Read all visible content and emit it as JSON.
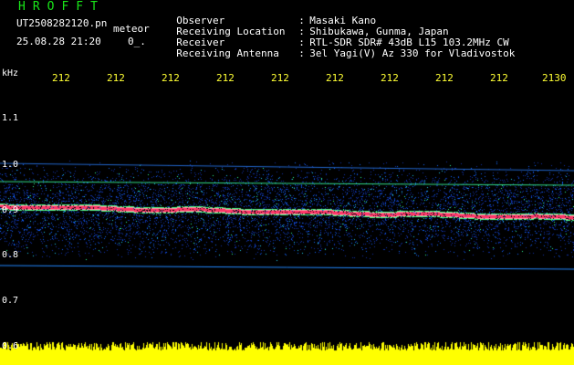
{
  "header": {
    "app_title": "HROFFT",
    "file_name": "UT2508282120.pn",
    "mode": "meteor",
    "timestamp": "25.08.28 21:20",
    "scale": "0_.",
    "info": [
      {
        "key": "Observer",
        "sep": ":",
        "value": "Masaki Kano"
      },
      {
        "key": "Receiving Location",
        "sep": ":",
        "value": "Shibukawa, Gunma, Japan"
      },
      {
        "key": "Receiver",
        "sep": ":",
        "value": "RTL-SDR SDR# 43dB L15 103.2MHz CW"
      },
      {
        "key": "Receiving Antenna",
        "sep": ":",
        "value": "3el Yagi(V) Az 330 for Vladivostok"
      }
    ]
  },
  "axes": {
    "y_unit": "kHz",
    "x_ticks": [
      "212",
      "212",
      "212",
      "212",
      "212",
      "212",
      "212",
      "212",
      "212",
      "2130"
    ],
    "y_ticks": [
      "1.1",
      "1.0",
      "0.9",
      "0.8",
      "0.7",
      "0.6"
    ]
  },
  "colors": {
    "background": "#000000",
    "title": "#19e619",
    "tick_x": "#ffff33",
    "signal": "#ff3366",
    "amplitude": "#ffff00"
  }
}
